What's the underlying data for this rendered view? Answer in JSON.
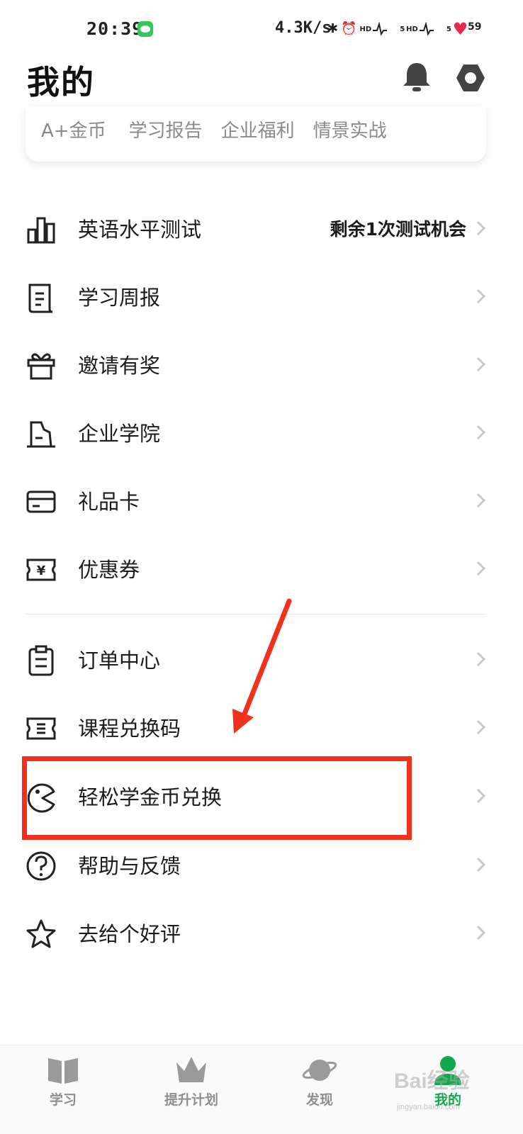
{
  "status_bar": {
    "time": "20:39",
    "net_speed": "4.3K/s",
    "hd_1": "HD",
    "signal_1": "5",
    "hd_2": "HD",
    "signal_2": "5",
    "battery": "59"
  },
  "header": {
    "title": "我的"
  },
  "quick_links": [
    "A+金币",
    "学习报告",
    "企业福利",
    "情景实战"
  ],
  "menu_group_1": [
    {
      "label": "英语水平测试",
      "extra": "剩余1次测试机会",
      "icon": "chart-bars-icon"
    },
    {
      "label": "学习周报",
      "icon": "report-scroll-icon"
    },
    {
      "label": "邀请有奖",
      "icon": "gift-icon"
    },
    {
      "label": "企业学院",
      "icon": "building-icon"
    },
    {
      "label": "礼品卡",
      "icon": "card-icon"
    },
    {
      "label": "优惠券",
      "icon": "coupon-icon"
    }
  ],
  "menu_group_2": [
    {
      "label": "订单中心",
      "icon": "clipboard-icon"
    },
    {
      "label": "课程兑换码",
      "icon": "ticket-icon"
    },
    {
      "label": "轻松学金币兑换",
      "icon": "pacman-icon"
    },
    {
      "label": "帮助与反馈",
      "icon": "help-icon"
    },
    {
      "label": "去给个好评",
      "icon": "star-icon"
    }
  ],
  "bottom_nav": [
    {
      "label": "学习",
      "icon": "book-icon"
    },
    {
      "label": "提升计划",
      "icon": "crown-icon"
    },
    {
      "label": "发现",
      "icon": "planet-icon"
    },
    {
      "label": "我的",
      "icon": "profile-icon",
      "active": true
    }
  ],
  "watermark": {
    "text": "Bai经验",
    "sub": "jingyan.baidu.com"
  },
  "colors": {
    "accent_green": "#11a94e",
    "annotation_red": "#f2311d",
    "text_primary": "#1c1c1c",
    "text_muted": "#8a8a8a"
  }
}
